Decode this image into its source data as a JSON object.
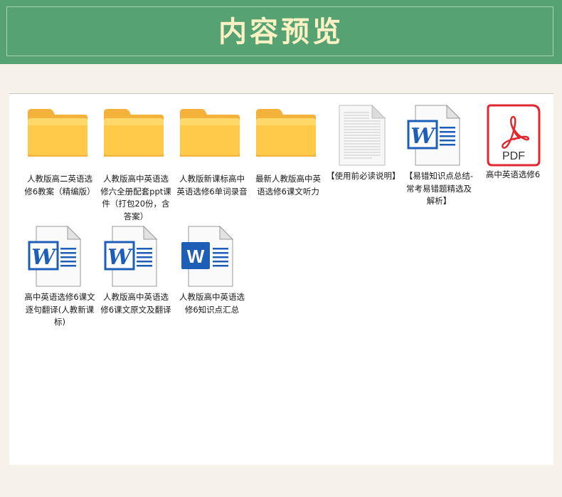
{
  "header": {
    "title": "内容预览"
  },
  "files": [
    {
      "name": "人教版高二英语选修6教案（精编版）",
      "icon": "folder-icon"
    },
    {
      "name": "人教版高中英语选修六全册配套ppt课件（打包20份，含答案）",
      "icon": "folder-icon"
    },
    {
      "name": "人教版新课标高中英语选修6单词录音",
      "icon": "folder-icon"
    },
    {
      "name": "最新人教版高中英语选修6课文听力",
      "icon": "folder-icon"
    },
    {
      "name": "【使用前必读说明】",
      "icon": "text-document-icon"
    },
    {
      "name": "【易错知识点总结-常考易错题精选及解析】",
      "icon": "word-document-icon"
    },
    {
      "name": "高中英语选修6",
      "icon": "pdf-icon",
      "badge": "PDF"
    },
    {
      "name": "高中英语选修6课文逐句翻译(人教新课标)",
      "icon": "word-document-icon"
    },
    {
      "name": "人教版高中英语选修6课文原文及翻译",
      "icon": "word-document-icon"
    },
    {
      "name": "人教版高中英语选修6知识点汇总",
      "icon": "word-modern-icon"
    }
  ],
  "colors": {
    "header_bg": "#56a272",
    "title": "#fbf1c4",
    "folder": "#ffc94a",
    "word_blue": "#1d5fb8",
    "pdf_red": "#e0282e"
  }
}
